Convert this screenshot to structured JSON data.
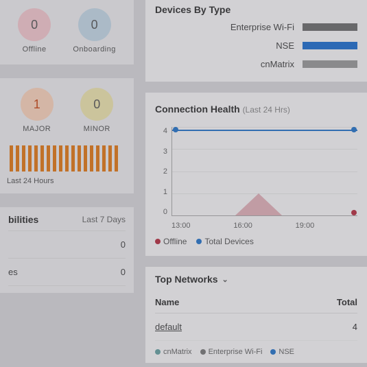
{
  "status": {
    "offline": {
      "value": "0",
      "label": "Offline"
    },
    "onboarding": {
      "value": "0",
      "label": "Onboarding"
    }
  },
  "alarms": {
    "major": {
      "value": "1",
      "label": "MAJOR"
    },
    "minor": {
      "value": "0",
      "label": "MINOR"
    },
    "last_label": "Last 24 Hours"
  },
  "bilities": {
    "title_fragment": "bilities",
    "range": "Last 7 Days",
    "rows": [
      {
        "label": "",
        "value": "0"
      },
      {
        "label": "es",
        "value": "0"
      }
    ]
  },
  "devices_by_type": {
    "title": "Devices By Type",
    "rows": [
      {
        "label": "Enterprise Wi-Fi",
        "color": "bar-gray"
      },
      {
        "label": "NSE",
        "color": "bar-blue"
      },
      {
        "label": "cnMatrix",
        "color": "bar-lgray"
      }
    ]
  },
  "connection_health": {
    "title": "Connection Health",
    "subtitle": "(Last 24 Hrs)",
    "legend": {
      "offline": "Offline",
      "total": "Total Devices"
    }
  },
  "chart_data": {
    "type": "line",
    "x": [
      "13:00",
      "16:00",
      "19:00"
    ],
    "ylim": [
      0,
      4
    ],
    "yticks": [
      0,
      1,
      2,
      3,
      4
    ],
    "series": [
      {
        "name": "Total Devices",
        "approx_values": [
          3.9,
          3.9,
          3.9,
          3.9
        ],
        "color": "#2a77c9"
      },
      {
        "name": "Offline",
        "approx_peak_value": 1,
        "approx_peak_time": "17:00",
        "color": "#b73344"
      }
    ],
    "title": "Connection Health (Last 24 Hrs)"
  },
  "top_networks": {
    "title": "Top Networks",
    "columns": {
      "name": "Name",
      "total": "Total"
    },
    "rows": [
      {
        "name": "default",
        "total": "4"
      }
    ],
    "legend": [
      "cnMatrix",
      "Enterprise Wi-Fi",
      "NSE"
    ]
  }
}
